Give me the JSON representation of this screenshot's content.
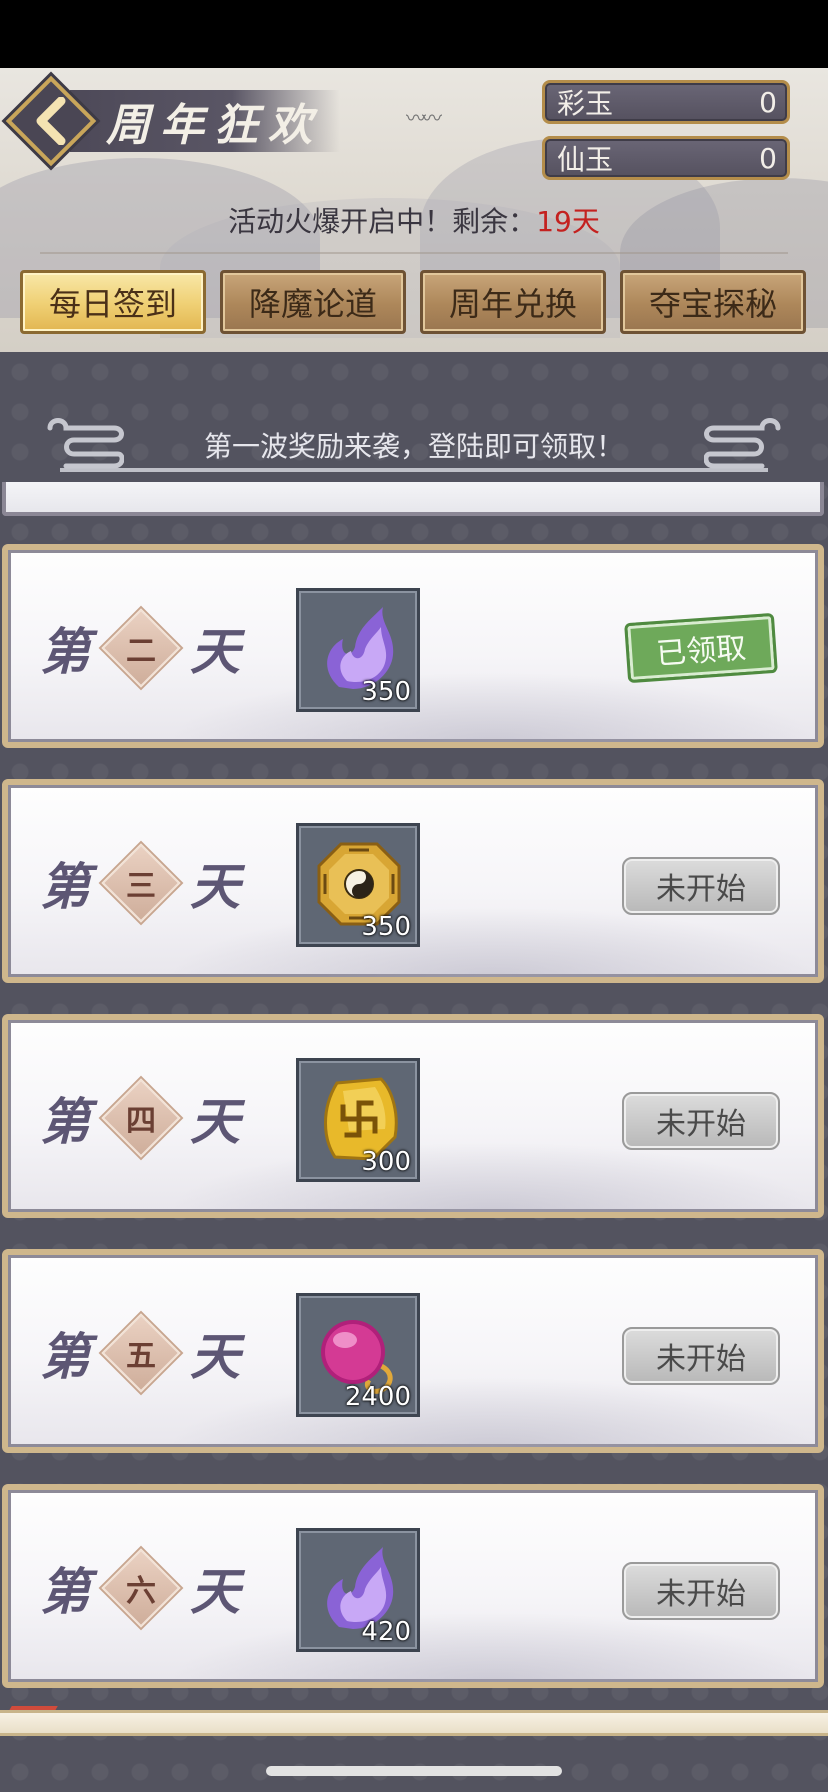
{
  "header": {
    "title": "周年狂欢",
    "currencies": [
      {
        "name": "彩玉",
        "value": "0"
      },
      {
        "name": "仙玉",
        "value": "0"
      }
    ],
    "activity_prefix": "活动火爆开启中！剩余：",
    "activity_days": "19天"
  },
  "tabs": [
    {
      "label": "每日签到",
      "active": true
    },
    {
      "label": "降魔论道",
      "active": false
    },
    {
      "label": "周年兑换",
      "active": false
    },
    {
      "label": "夺宝探秘",
      "active": false
    }
  ],
  "notice": "第一波奖励来袭，登陆即可领取！",
  "day_prefix": "第",
  "day_suffix": "天",
  "days": [
    {
      "num": "二",
      "item_icon": "purple-flame-crystal-icon",
      "count": "350",
      "status": "已领取"
    },
    {
      "num": "三",
      "item_icon": "bagua-disc-icon",
      "count": "350",
      "status": "未开始"
    },
    {
      "num": "四",
      "item_icon": "gold-swastika-stone-icon",
      "count": "300",
      "status": "未开始"
    },
    {
      "num": "五",
      "item_icon": "purple-orb-icon",
      "count": "2400",
      "status": "未开始"
    },
    {
      "num": "六",
      "item_icon": "purple-flame-crystal-icon",
      "count": "420",
      "status": "未开始"
    }
  ],
  "colors": {
    "accent_gold": "#e2b651",
    "days_red": "#c4211f",
    "claimed_green": "#6ea95a"
  }
}
